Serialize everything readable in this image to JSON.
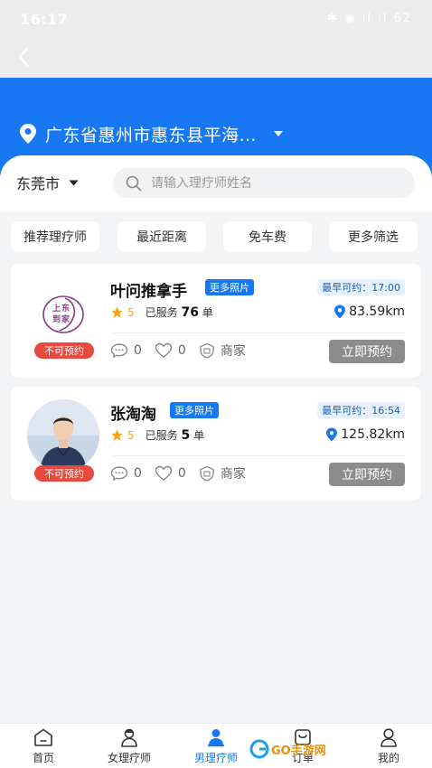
{
  "status_bar": {
    "time": "16:17",
    "icons": "✱ ◉ ıl ıl 62"
  },
  "location": {
    "text": "广东省惠州市惠东县平海…"
  },
  "filter": {
    "city": "东莞市",
    "search_placeholder": "请输入理疗师姓名",
    "chips": [
      "推荐理疗师",
      "最近距离",
      "免车费",
      "更多筛选"
    ]
  },
  "therapists": [
    {
      "name": "叶问推拿手",
      "more_photos": "更多照片",
      "earliest": "最早可约：17:00",
      "rating": "5",
      "served_prefix": "已服务",
      "served_count": "76",
      "served_suffix": "单",
      "distance": "83.59km",
      "status": "不可预约",
      "comments": "0",
      "likes": "0",
      "shop": "商家",
      "book": "立即预约",
      "logo_text_1": "上",
      "logo_text_2": "东",
      "logo_text_3": "到",
      "logo_text_4": "家"
    },
    {
      "name": "张淘淘",
      "more_photos": "更多照片",
      "earliest": "最早可约：16:54",
      "rating": "5",
      "served_prefix": "已服务",
      "served_count": "5",
      "served_suffix": "单",
      "distance": "125.82km",
      "status": "不可预约",
      "comments": "0",
      "likes": "0",
      "shop": "商家",
      "book": "立即预约"
    }
  ],
  "tabbar": {
    "items": [
      {
        "label": "首页",
        "icon": "home-icon"
      },
      {
        "label": "女理疗师",
        "icon": "female-therapist-icon"
      },
      {
        "label": "男理疗师",
        "icon": "male-therapist-icon",
        "active": true
      },
      {
        "label": "订单",
        "icon": "order-icon"
      },
      {
        "label": "我的",
        "icon": "profile-icon"
      }
    ]
  },
  "watermark": {
    "text": "GO手游网"
  },
  "colors": {
    "primary": "#1877f2",
    "danger": "#e84a3f",
    "star": "#f5a623",
    "disabled_button": "#8c8c8c"
  }
}
